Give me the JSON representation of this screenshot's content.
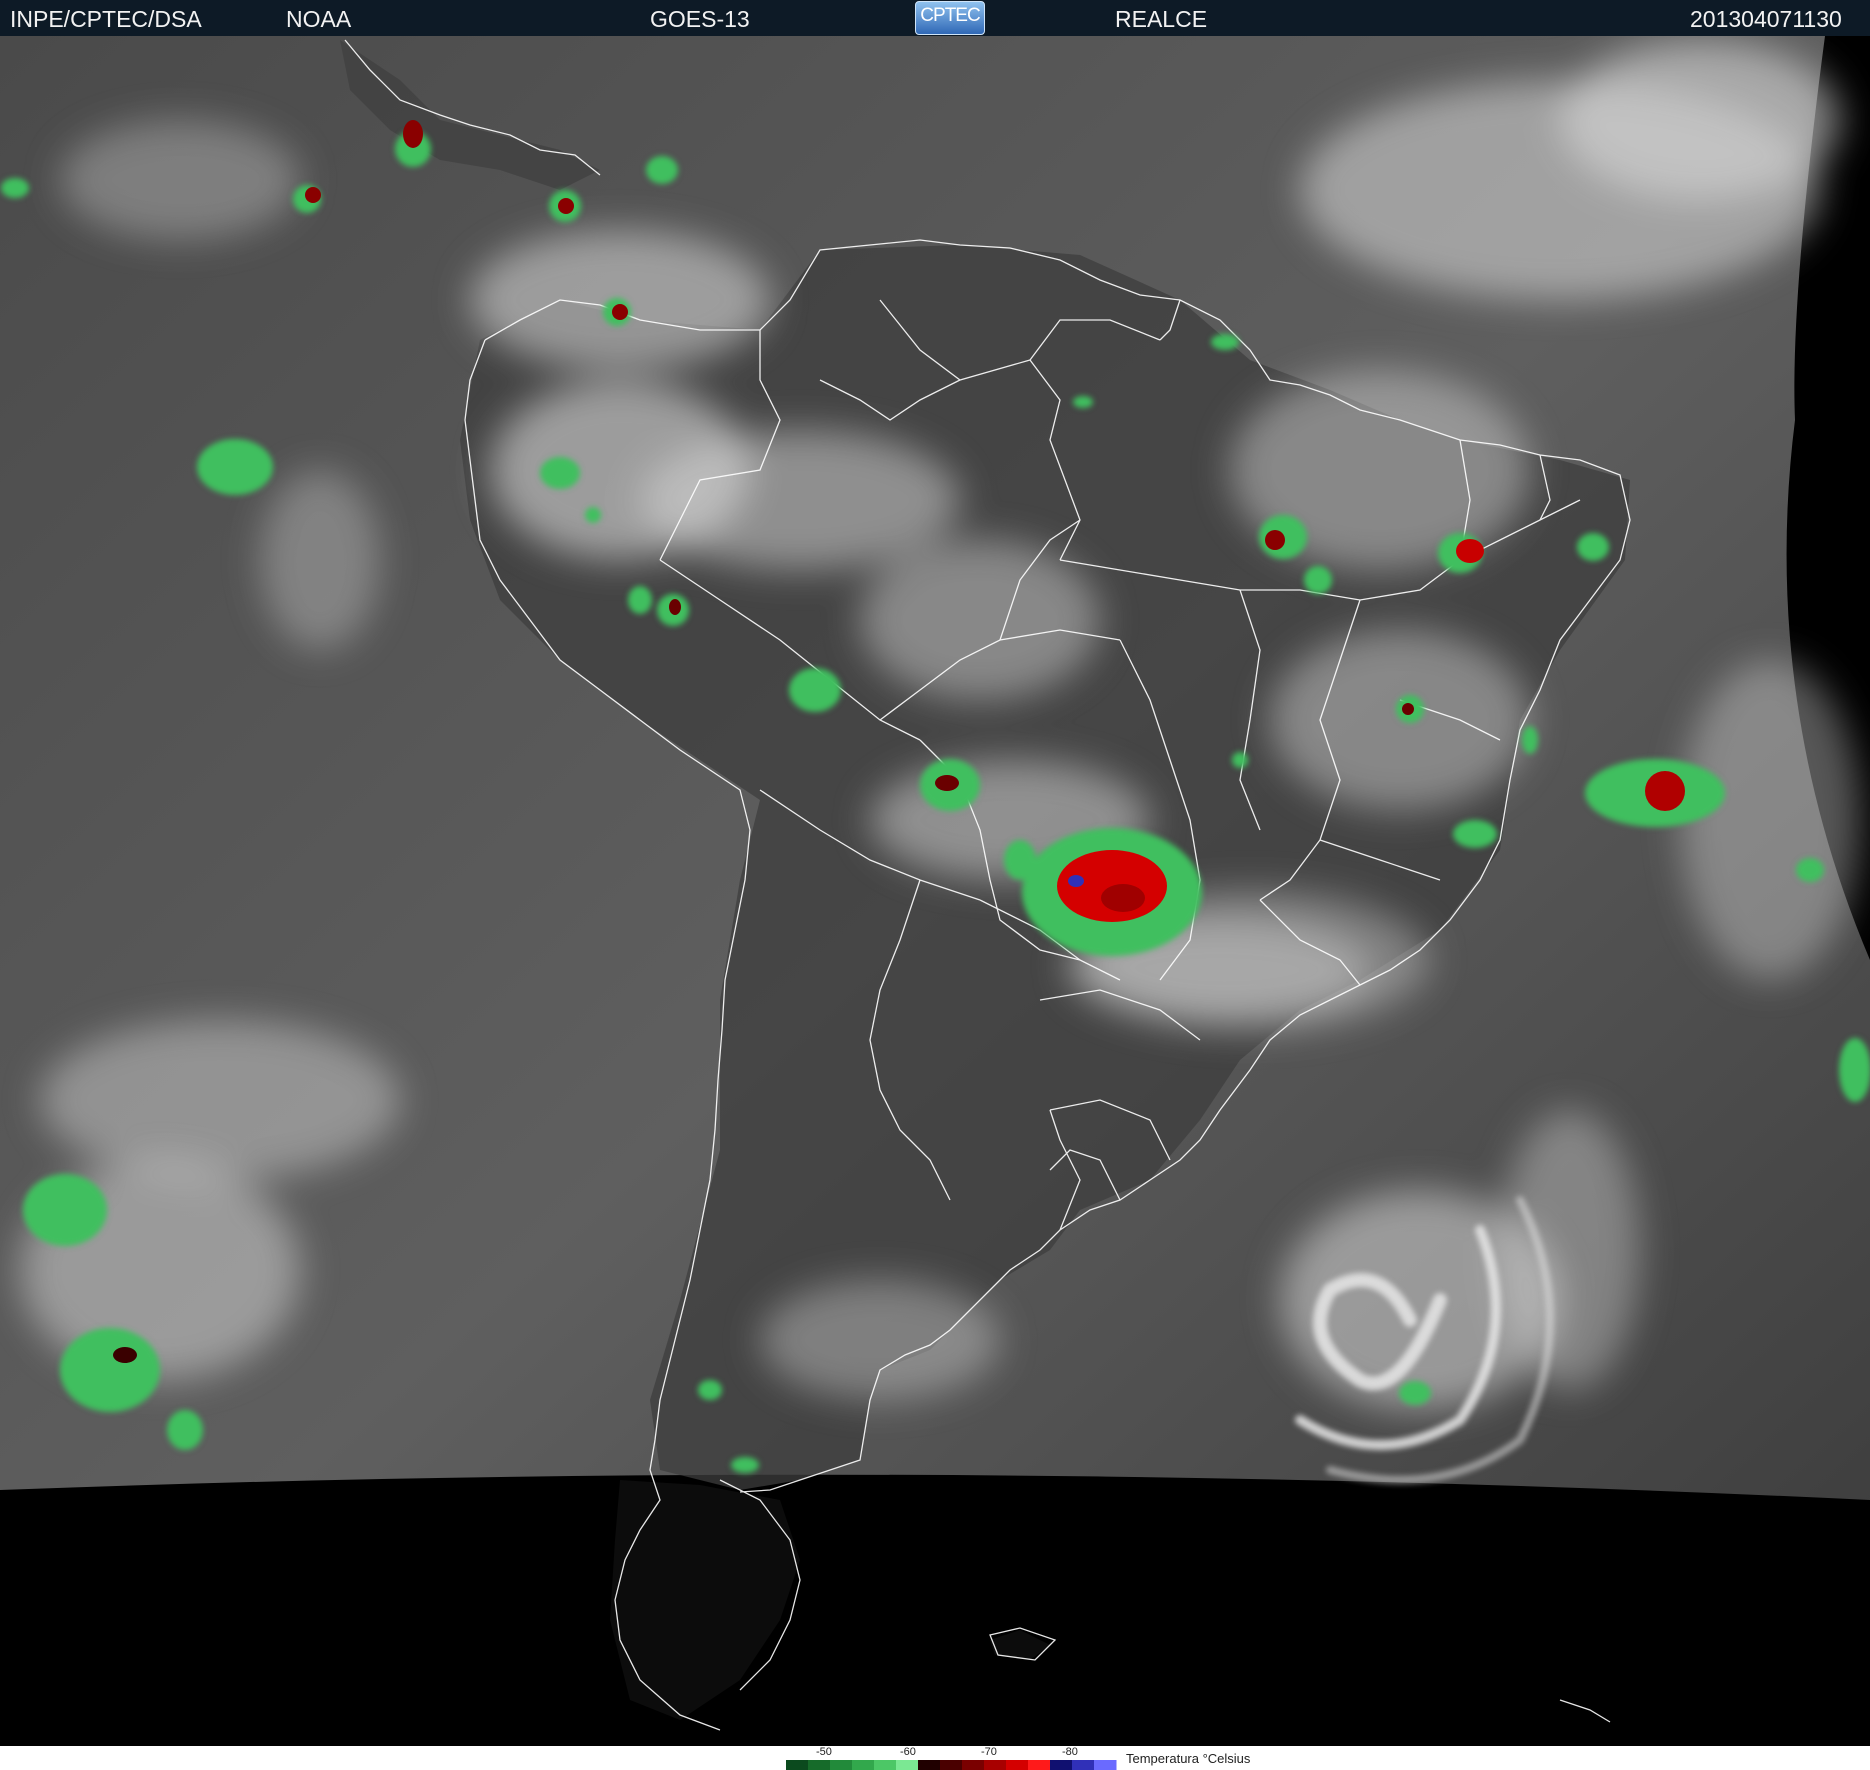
{
  "header": {
    "source": "INPE/CPTEC/DSA",
    "agency": "NOAA",
    "satellite": "GOES-13",
    "logo": "CPTEC",
    "product": "REALCE",
    "datetime": "201304071130"
  },
  "legend": {
    "title": "Temperatura °Celsius",
    "ticks": [
      "-50",
      "-60",
      "-70",
      "-80"
    ],
    "colors": [
      "#0b4a1e",
      "#166b2a",
      "#228a3a",
      "#32a84c",
      "#4cc766",
      "#7be893",
      "#200000",
      "#4a0000",
      "#7a0000",
      "#a80000",
      "#d40000",
      "#ff1a1a",
      "#101070",
      "#3030b8",
      "#6a6aff"
    ]
  },
  "colors": {
    "header_bg": "#0d1a26",
    "cloud_tops_cold": "#d40000",
    "cloud_tops_cool": "#3fbf5f",
    "coastline": "#ffffff",
    "space": "#000000"
  }
}
